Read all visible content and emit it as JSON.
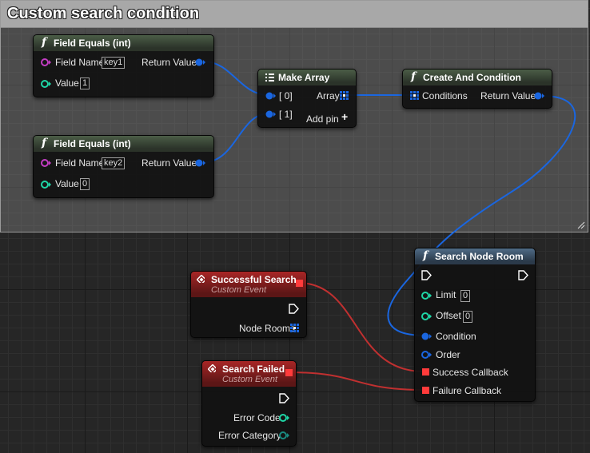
{
  "comment": {
    "title": "Custom search condition"
  },
  "nodes": {
    "field_equals_1": {
      "title": "Field Equals (int)",
      "field_name_label": "Field Name",
      "field_name_value": "key1",
      "value_label": "Value",
      "value_value": "1",
      "return_label": "Return Value"
    },
    "field_equals_2": {
      "title": "Field Equals (int)",
      "field_name_label": "Field Name",
      "field_name_value": "key2",
      "value_label": "Value",
      "value_value": "0",
      "return_label": "Return Value"
    },
    "make_array": {
      "title": "Make Array",
      "in0": "[ 0]",
      "in1": "[ 1]",
      "array_label": "Array",
      "add_pin": "Add pin"
    },
    "create_and": {
      "title": "Create And Condition",
      "conditions_label": "Conditions",
      "return_label": "Return Value"
    },
    "search_node_room": {
      "title": "Search Node Room",
      "limit_label": "Limit",
      "limit_value": "0",
      "offset_label": "Offset",
      "offset_value": "0",
      "condition_label": "Condition",
      "order_label": "Order",
      "success_label": "Success Callback",
      "failure_label": "Failure Callback"
    },
    "successful_search": {
      "title": "Successful Search",
      "subtitle": "Custom Event",
      "node_rooms_label": "Node Rooms"
    },
    "search_failed": {
      "title": "Search Failed",
      "subtitle": "Custom Event",
      "error_code_label": "Error Code",
      "error_category_label": "Error Category"
    }
  },
  "colors": {
    "struct_pin": "#1a66e0",
    "name_pin": "#c23dc2",
    "int_pin": "#1fd6a6",
    "delegate_pin": "#ff3b3b",
    "wire_blue": "#1a66e0",
    "wire_red": "#c03030"
  },
  "icons": [
    "function-icon",
    "event-icon",
    "array-icon",
    "exec-pin-icon",
    "add-icon"
  ]
}
